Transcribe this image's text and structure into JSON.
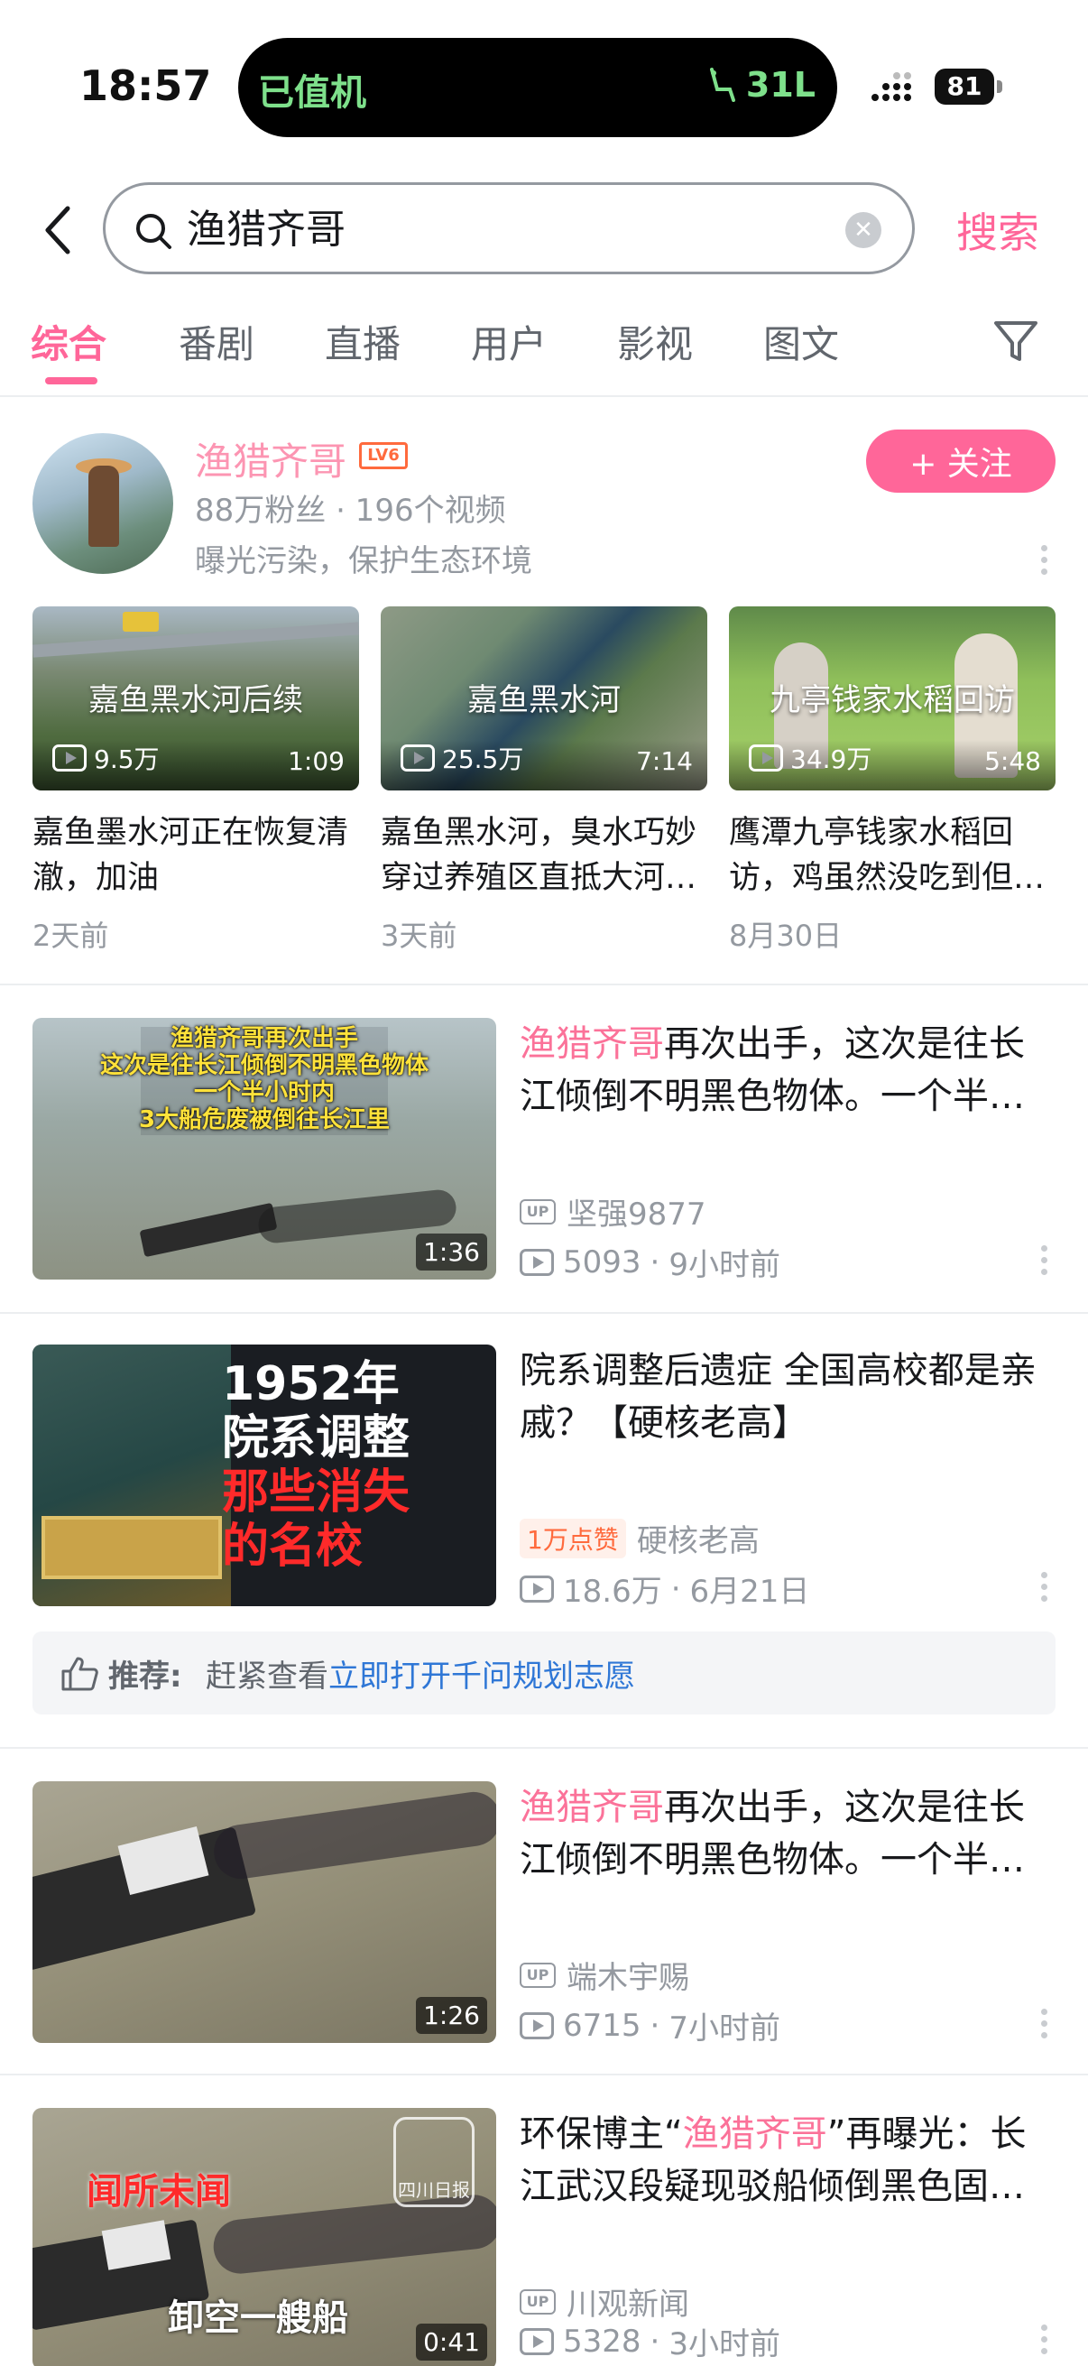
{
  "status": {
    "time": "18:57",
    "island_left": "已值机",
    "island_right": "31L",
    "battery": "81"
  },
  "search": {
    "query": "渔猎齐哥",
    "submit_label": "搜索"
  },
  "tabs": [
    {
      "label": "综合"
    },
    {
      "label": "番剧"
    },
    {
      "label": "直播"
    },
    {
      "label": "用户"
    },
    {
      "label": "影视"
    },
    {
      "label": "图文"
    }
  ],
  "user": {
    "name": "渔猎齐哥",
    "level": "LV6",
    "stats": "88万粉丝 · 196个视频",
    "desc": "曝光污染，保护生态环境",
    "follow_label": "+ 关注",
    "videos": [
      {
        "overlay": "嘉鱼黑水河后续",
        "views": "9.5万",
        "duration": "1:09",
        "title": "嘉鱼墨水河正在恢复清澈，加油",
        "date": "2天前"
      },
      {
        "overlay": "嘉鱼黑水河",
        "views": "25.5万",
        "duration": "7:14",
        "title": "嘉鱼黑水河，臭水巧妙穿过养殖区直抵大河…",
        "date": "3天前"
      },
      {
        "overlay": "九亭钱家水稻回访",
        "views": "34.9万",
        "duration": "5:48",
        "title": "鹰潭九亭钱家水稻回访，鸡虽然没吃到但…",
        "date": "8月30日"
      }
    ]
  },
  "items": [
    {
      "title_hl": "渔猎齐哥",
      "title_rest": "再次出手，这次是往长江倾倒不明黑色物体。一个半…",
      "thumb_lines": [
        "渔猎齐哥再次出手",
        "这次是往长江倾倒不明黑色物体",
        "一个半小时内",
        "3大船危废被倒往长江里"
      ],
      "duration": "1:36",
      "uploader": "坚强9877",
      "views": "5093",
      "time": "9小时前"
    },
    {
      "title": "院系调整后遗症 全国高校都是亲戚？【硬核老高】",
      "thumb_lines": [
        "1952年",
        "院系调整",
        "那些消失",
        "的名校"
      ],
      "like_badge": "1万点赞",
      "uploader": "硬核老高",
      "views": "18.6万",
      "time": "6月21日"
    },
    {
      "title_hl": "渔猎齐哥",
      "title_rest": "再次出手，这次是往长江倾倒不明黑色物体。一个半…",
      "duration": "1:26",
      "uploader": "端木宇赐",
      "views": "6715",
      "time": "7小时前"
    },
    {
      "title_pre": "环保博主“",
      "title_hl": "渔猎齐哥",
      "title_rest": "”再曝光：长江武汉段疑现驳船倾倒黑色固…",
      "thumb_lines": [
        "闻所未闻",
        "卸空一艘船"
      ],
      "watermark": "四川日报",
      "duration": "0:41",
      "uploader": "川观新闻",
      "views": "5328",
      "time": "3小时前"
    }
  ],
  "recommend": {
    "label": "推荐:",
    "text": "赶紧查看",
    "link": "立即打开千问规划志愿"
  },
  "colors": {
    "accent": "#ff6699",
    "link": "#2f77d6",
    "muted": "#9499a0"
  }
}
